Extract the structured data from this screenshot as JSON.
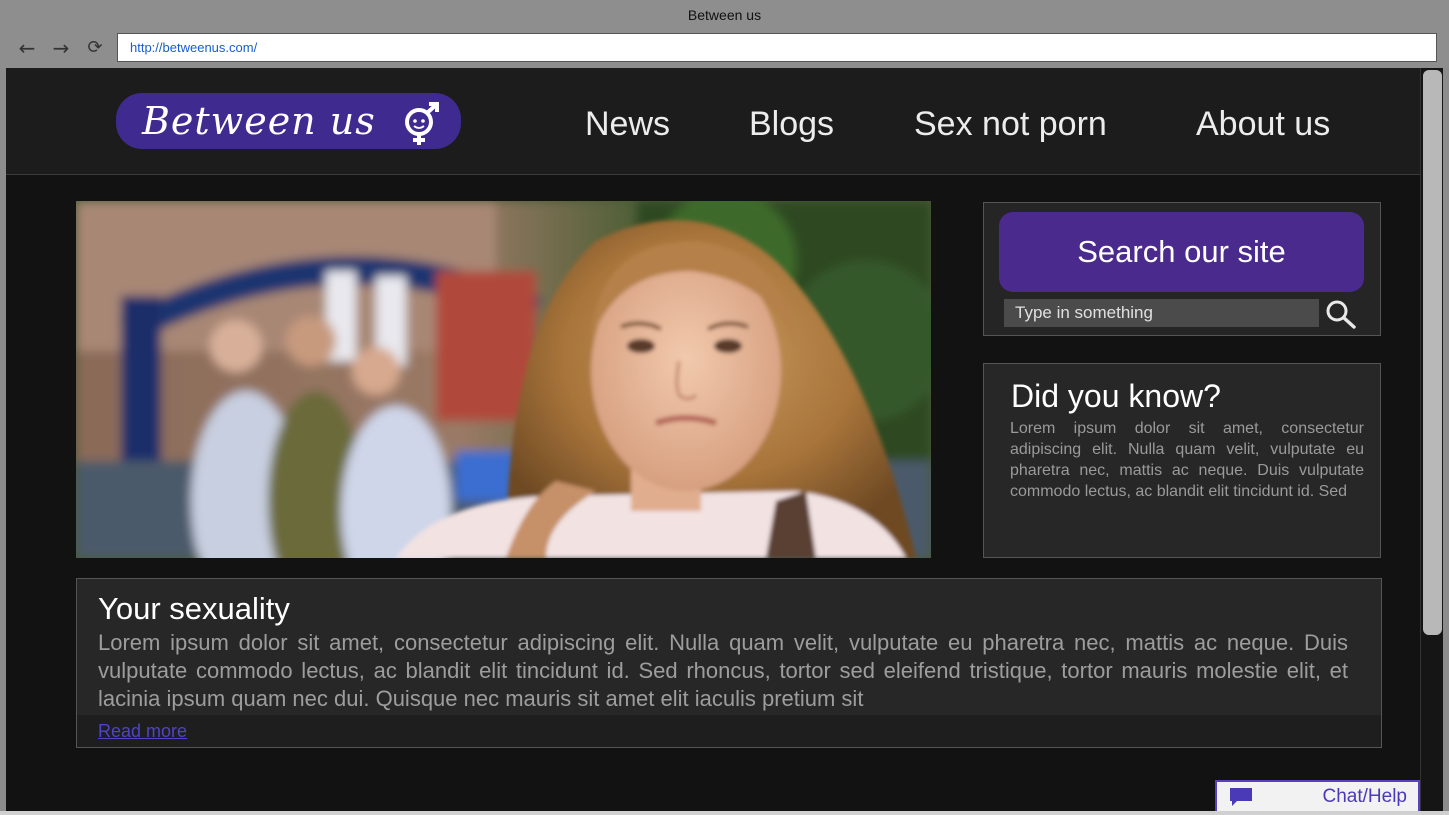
{
  "browser": {
    "window_title": "Between us",
    "url": "http://betweenus.com/"
  },
  "header": {
    "logo_text": "Between us",
    "nav": [
      "News",
      "Blogs",
      "Sex not porn",
      "About us"
    ]
  },
  "search": {
    "button_label": "Search our site",
    "placeholder": "Type in something"
  },
  "did_you_know": {
    "title": "Did you know?",
    "body": "Lorem ipsum dolor sit amet, consectetur adipiscing elit. Nulla quam velit, vulputate eu pharetra nec, mattis ac neque. Duis vulputate commodo lectus, ac blandit elit tincidunt id. Sed"
  },
  "article": {
    "title": "Your sexuality",
    "body": "Lorem ipsum dolor sit amet, consectetur adipiscing elit. Nulla quam velit, vulputate eu pharetra nec, mattis ac neque. Duis vulputate commodo lectus, ac blandit elit tincidunt id. Sed rhoncus, tortor sed eleifend tristique, tortor mauris molestie elit, et lacinia ipsum quam nec dui. Quisque nec mauris sit amet elit iaculis pretium sit",
    "read_more": "Read more"
  },
  "chat": {
    "label": "Chat/Help"
  },
  "colors": {
    "brand_purple": "#4a2a8c",
    "link": "#4f44c8",
    "background": "#121212",
    "panel": "#272727"
  },
  "icons": [
    "back-arrow-icon",
    "forward-arrow-icon",
    "reload-icon",
    "gender-face-icon",
    "search-icon",
    "chat-bubble-icon"
  ]
}
